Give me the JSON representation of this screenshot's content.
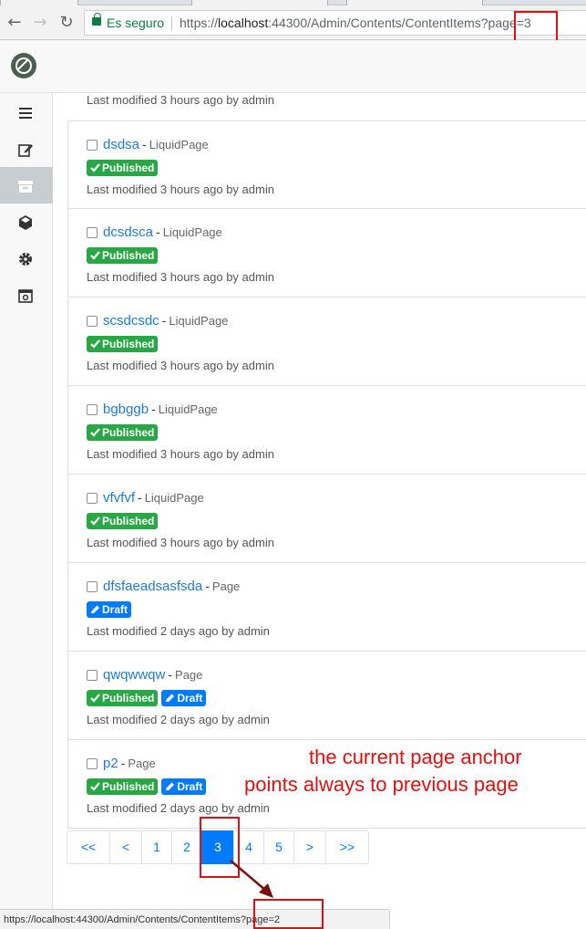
{
  "browser": {
    "secure_label": "Es seguro",
    "url_scheme": "https://",
    "url_host": "localhost",
    "url_path": ":44300/Admin/Contents/ContentItems?page=3"
  },
  "sidebar": {
    "items": [
      {
        "icon": "menu-icon"
      },
      {
        "icon": "edit-icon"
      },
      {
        "icon": "archive-icon",
        "active": true
      },
      {
        "icon": "cube-icon"
      },
      {
        "icon": "gear-icon"
      },
      {
        "icon": "camera-icon"
      }
    ]
  },
  "content": {
    "partial_modified": "Last modified 3 hours ago by admin",
    "items": [
      {
        "title": "dsdsa",
        "type": "LiquidPage",
        "published": "Published",
        "draft": "",
        "modified": "Last modified 3 hours ago by admin"
      },
      {
        "title": "dcsdsca",
        "type": "LiquidPage",
        "published": "Published",
        "draft": "",
        "modified": "Last modified 3 hours ago by admin"
      },
      {
        "title": "scsdcsdc",
        "type": "LiquidPage",
        "published": "Published",
        "draft": "",
        "modified": "Last modified 3 hours ago by admin"
      },
      {
        "title": "bgbggb",
        "type": "LiquidPage",
        "published": "Published",
        "draft": "",
        "modified": "Last modified 3 hours ago by admin"
      },
      {
        "title": "vfvfvf",
        "type": "LiquidPage",
        "published": "Published",
        "draft": "",
        "modified": "Last modified 3 hours ago by admin"
      },
      {
        "title": "dfsfaeadsasfsda",
        "type": "Page",
        "published": "",
        "draft": "Draft",
        "modified": "Last modified 2 days ago by admin"
      },
      {
        "title": "qwqwwqw",
        "type": "Page",
        "published": "Published",
        "draft": "Draft",
        "modified": "Last modified 2 days ago by admin"
      },
      {
        "title": "p2",
        "type": "Page",
        "published": "Published",
        "draft": "Draft",
        "modified": "Last modified 2 days ago by admin"
      }
    ]
  },
  "pagination": {
    "items": [
      {
        "label": "<<",
        "active": false
      },
      {
        "label": "<",
        "active": false
      },
      {
        "label": "1",
        "active": false
      },
      {
        "label": "2",
        "active": false
      },
      {
        "label": "3",
        "active": true
      },
      {
        "label": "4",
        "active": false
      },
      {
        "label": "5",
        "active": false
      },
      {
        "label": ">",
        "active": false
      },
      {
        "label": ">>",
        "active": false
      }
    ]
  },
  "annotation": {
    "line1": "the current page anchor",
    "line2": "points always to previous page",
    "color": "#e01010"
  },
  "statusbar": {
    "url": "https://localhost:44300/Admin/Contents/ContentItems?page=2"
  },
  "colors": {
    "link": "#1e7bd4",
    "published": "#28a745",
    "draft": "#007bff",
    "active_page": "#007bff"
  }
}
